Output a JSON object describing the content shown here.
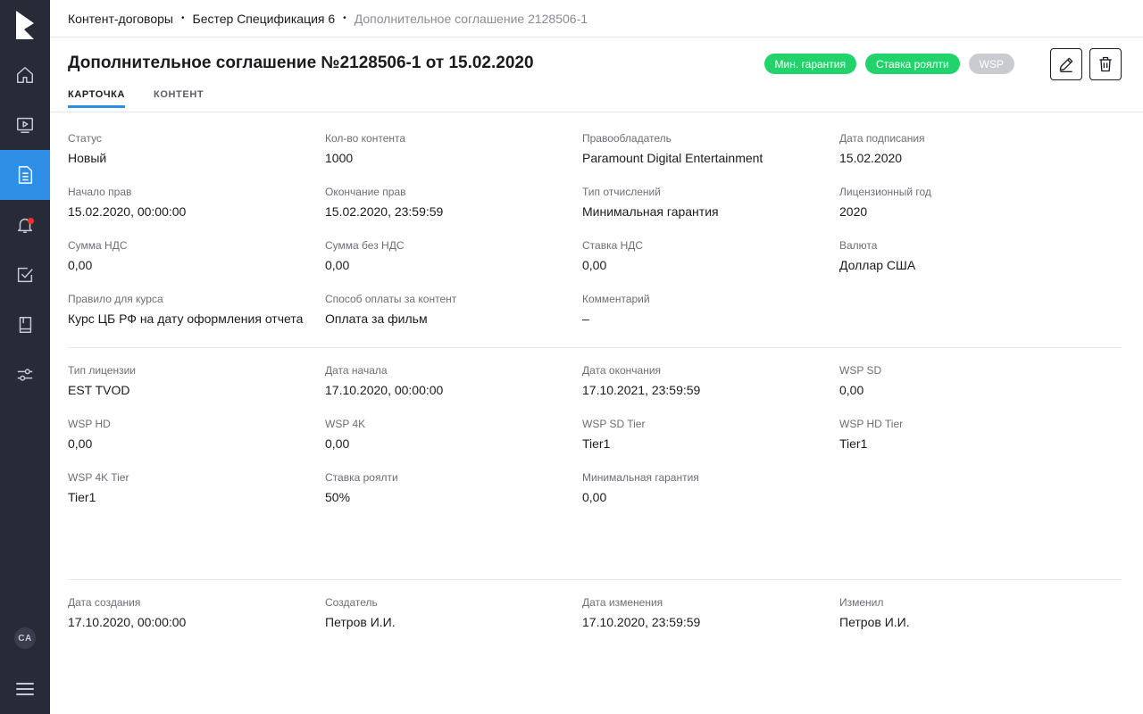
{
  "breadcrumb": [
    "Контент-договоры",
    "Бестер Спецификация 6",
    "Дополнительное соглашение 2128506-1"
  ],
  "breadcrumb_separator": "•",
  "title": "Дополнительное соглашение №2128506-1 от 15.02.2020",
  "badges": [
    {
      "label": "Мин. гарантия",
      "color": "#22d36b"
    },
    {
      "label": "Ставка роялти",
      "color": "#22d36b"
    },
    {
      "label": "WSP",
      "color": "#c9cbd0"
    }
  ],
  "tabs": [
    {
      "label": "Карточка",
      "active": true
    },
    {
      "label": "Контент",
      "active": false
    }
  ],
  "sidebar": {
    "active_index": 2,
    "avatar": "CA",
    "icons": [
      "home-icon",
      "video-icon",
      "document-icon",
      "bell-icon",
      "checkbox-icon",
      "book-icon",
      "sliders-icon"
    ]
  },
  "sections": [
    [
      {
        "label": "Статус",
        "value": "Новый"
      },
      {
        "label": "Кол-во контента",
        "value": "1000"
      },
      {
        "label": "Правообладатель",
        "value": "Paramount Digital Entertainment"
      },
      {
        "label": "Дата подписания",
        "value": "15.02.2020"
      },
      {
        "label": "Начало прав",
        "value": "15.02.2020, 00:00:00"
      },
      {
        "label": "Окончание прав",
        "value": "15.02.2020, 23:59:59"
      },
      {
        "label": "Тип отчислений",
        "value": "Минимальная гарантия"
      },
      {
        "label": "Лицензионный год",
        "value": "2020"
      },
      {
        "label": "Сумма НДС",
        "value": "0,00"
      },
      {
        "label": "Сумма без НДС",
        "value": "0,00"
      },
      {
        "label": "Ставка НДС",
        "value": "0,00"
      },
      {
        "label": "Валюта",
        "value": "Доллар США"
      },
      {
        "label": "Правило для курса",
        "value": "Курс ЦБ РФ на дату оформления отчета"
      },
      {
        "label": "Способ оплаты за контент",
        "value": "Оплата за фильм"
      },
      {
        "label": "Комментарий",
        "value": "–"
      }
    ],
    [
      {
        "label": "Тип лицензии",
        "value": "EST TVOD"
      },
      {
        "label": "Дата начала",
        "value": "17.10.2020, 00:00:00"
      },
      {
        "label": "Дата окончания",
        "value": "17.10.2021, 23:59:59"
      },
      {
        "label": "WSP SD",
        "value": "0,00"
      },
      {
        "label": "WSP HD",
        "value": "0,00"
      },
      {
        "label": "WSP 4K",
        "value": "0,00"
      },
      {
        "label": "WSP SD Tier",
        "value": "Tier1"
      },
      {
        "label": "WSP HD Tier",
        "value": "Tier1"
      },
      {
        "label": "WSP 4K Tier",
        "value": "Tier1"
      },
      {
        "label": "Ставка роялти",
        "value": "50%"
      },
      {
        "label": "Минимальная гарантия",
        "value": "0,00"
      }
    ],
    [
      {
        "label": "Дата создания",
        "value": "17.10.2020, 00:00:00"
      },
      {
        "label": "Создатель",
        "value": "Петров И.И."
      },
      {
        "label": "Дата изменения",
        "value": "17.10.2020, 23:59:59"
      },
      {
        "label": "Изменил",
        "value": "Петров И.И."
      }
    ]
  ]
}
